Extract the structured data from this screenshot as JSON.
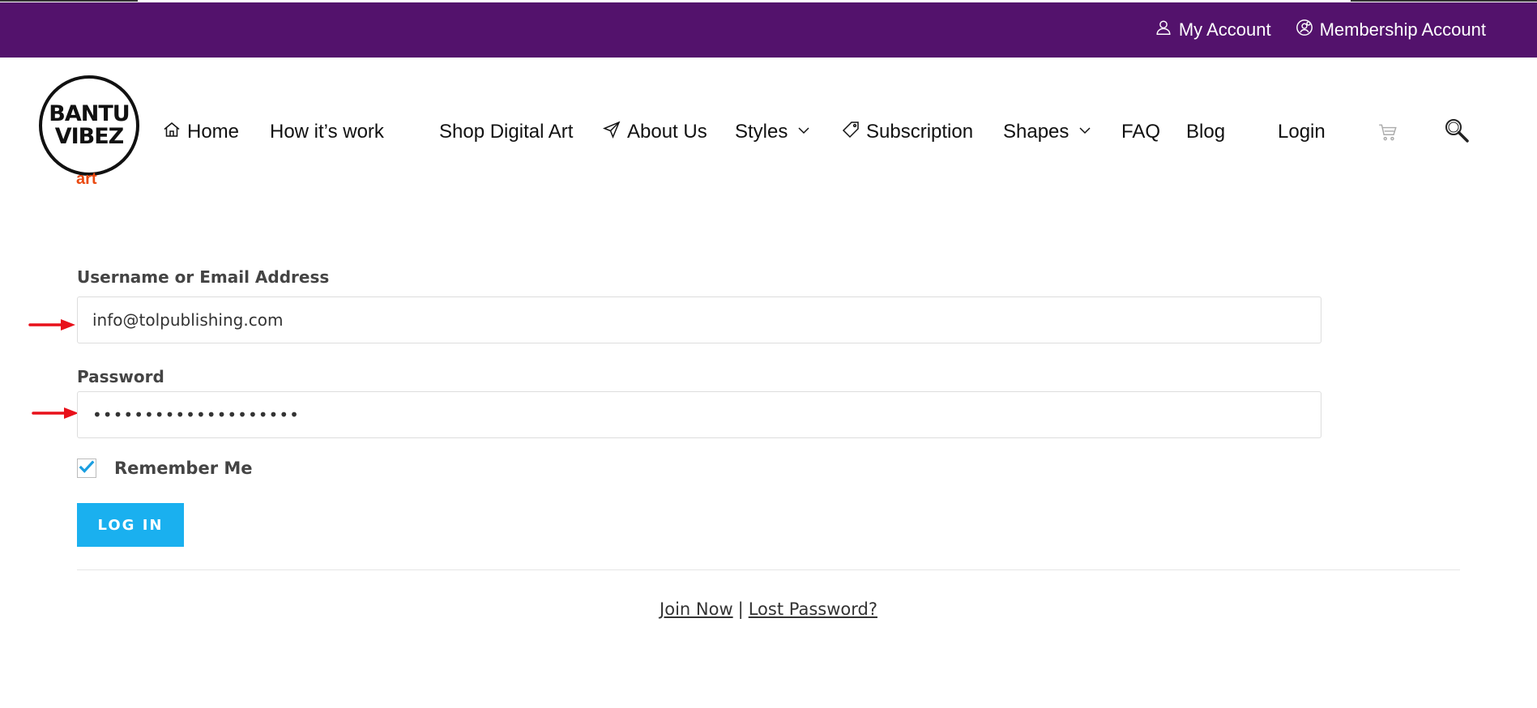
{
  "top_bar": {
    "my_account": "My Account",
    "membership_account": "Membership Account"
  },
  "logo": {
    "line1": "BANTU",
    "line2": "VIBEZ",
    "line3": "art"
  },
  "nav": {
    "home": "Home",
    "how_it_works": "How it’s work",
    "shop_digital_art": "Shop Digital Art",
    "about_us": "About Us",
    "styles": "Styles",
    "subscription": "Subscription",
    "shapes": "Shapes",
    "faq": "FAQ",
    "blog": "Blog",
    "login": "Login"
  },
  "form": {
    "username_label": "Username or Email Address",
    "username_value": "info@tolpublishing.com",
    "password_label": "Password",
    "password_value": "••••••••••••••••••••",
    "remember_label": "Remember Me",
    "remember_checked": true,
    "login_button": "LOG IN"
  },
  "footer": {
    "join_now": "Join Now",
    "separator": "|",
    "lost_password": "Lost Password?"
  },
  "colors": {
    "top_bar": "#53126c",
    "accent": "#1ab0ef",
    "logo_art": "#ea4a11",
    "annotation_arrow": "#e8101a"
  },
  "icons": [
    "user-icon",
    "membership-icon",
    "home-icon",
    "send-icon",
    "chevron-down-icon",
    "tag-icon",
    "cart-icon",
    "search-icon",
    "checkmark-icon",
    "arrow-icon"
  ]
}
